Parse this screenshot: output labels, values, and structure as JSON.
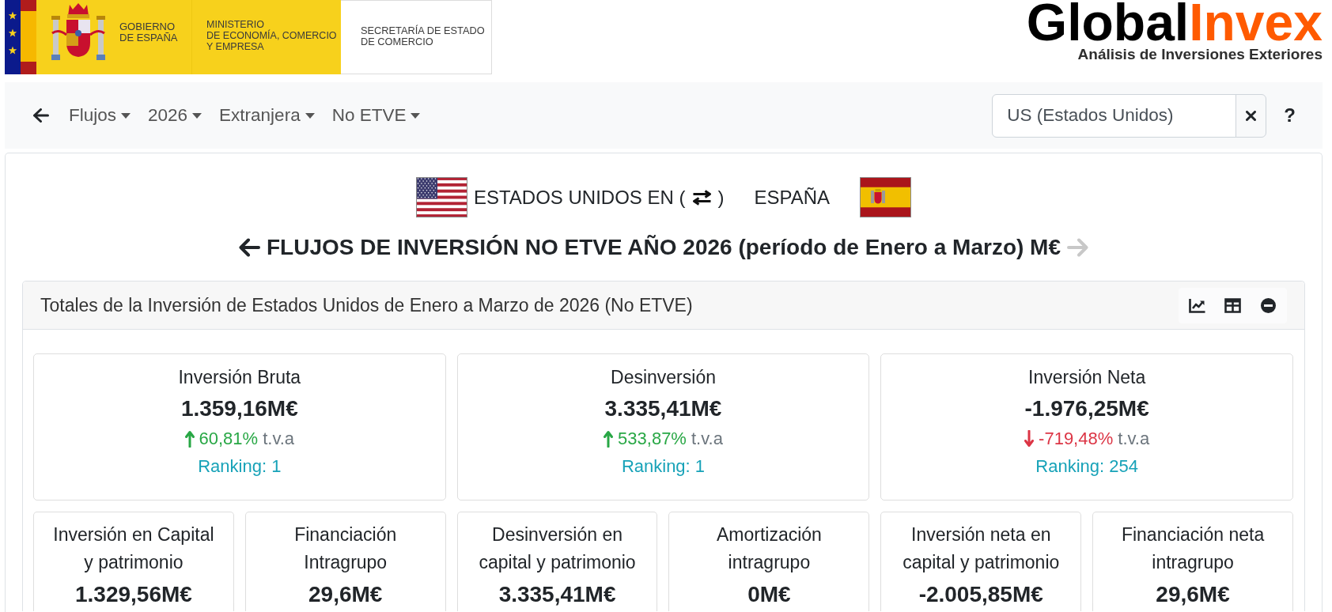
{
  "header": {
    "government": "GOBIERNO\nDE ESPAÑA",
    "ministry": "MINISTERIO\nDE ECONOMÍA, COMERCIO\nY EMPRESA",
    "secretariat": "SECRETARÍA DE ESTADO\nDE COMERCIO",
    "brand": {
      "name": "Global",
      "highlight": "Invex"
    },
    "tagline": "Análisis de Inversiones Exteriores"
  },
  "navbar": {
    "menus": [
      "Flujos",
      "2026",
      "Extranjera",
      "No ETVE"
    ],
    "search": {
      "value": "US (Estados Unidos)"
    },
    "help": "?"
  },
  "route": {
    "origin": "ESTADOS UNIDOS EN (",
    "closing": ")",
    "destination": "ESPAÑA"
  },
  "title": {
    "text": "FLUJOS DE INVERSIÓN NO ETVE AÑO 2026 (período de Enero a Marzo) M€",
    "previous": {
      "disabled": false
    },
    "next": {
      "disabled": true
    }
  },
  "panel": {
    "title": "Totales de la Inversión de Estados Unidos de Enero a Marzo de 2026 (No ETVE)",
    "totals": [
      {
        "title": "Inversión Bruta",
        "value": "1.359,16M€",
        "increase": true,
        "change": "60,81%",
        "unit": "t.v.a",
        "ranking": "Ranking: 1"
      },
      {
        "title": "Desinversión",
        "value": "3.335,41M€",
        "increase": true,
        "change": "533,87%",
        "unit": "t.v.a",
        "ranking": "Ranking: 1"
      },
      {
        "title": "Inversión Neta",
        "value": "-1.976,25M€",
        "increase": false,
        "change": "-719,48%",
        "unit": "t.v.a",
        "ranking": "Ranking: 254"
      }
    ],
    "details": [
      {
        "title": "Inversión en Capital\ny patrimonio",
        "value": "1.329,56M€"
      },
      {
        "title": "Financiación\nIntragrupo",
        "value": "29,6M€"
      },
      {
        "title": "Desinversión en\ncapital y patrimonio",
        "value": "3.335,41M€"
      },
      {
        "title": "Amortización\nintragrupo",
        "value": "0M€"
      },
      {
        "title": "Inversión neta en\ncapital y patrimonio",
        "value": "-2.005,85M€"
      },
      {
        "title": "Financiación neta\nintragrupo",
        "value": "29,6M€"
      }
    ]
  }
}
